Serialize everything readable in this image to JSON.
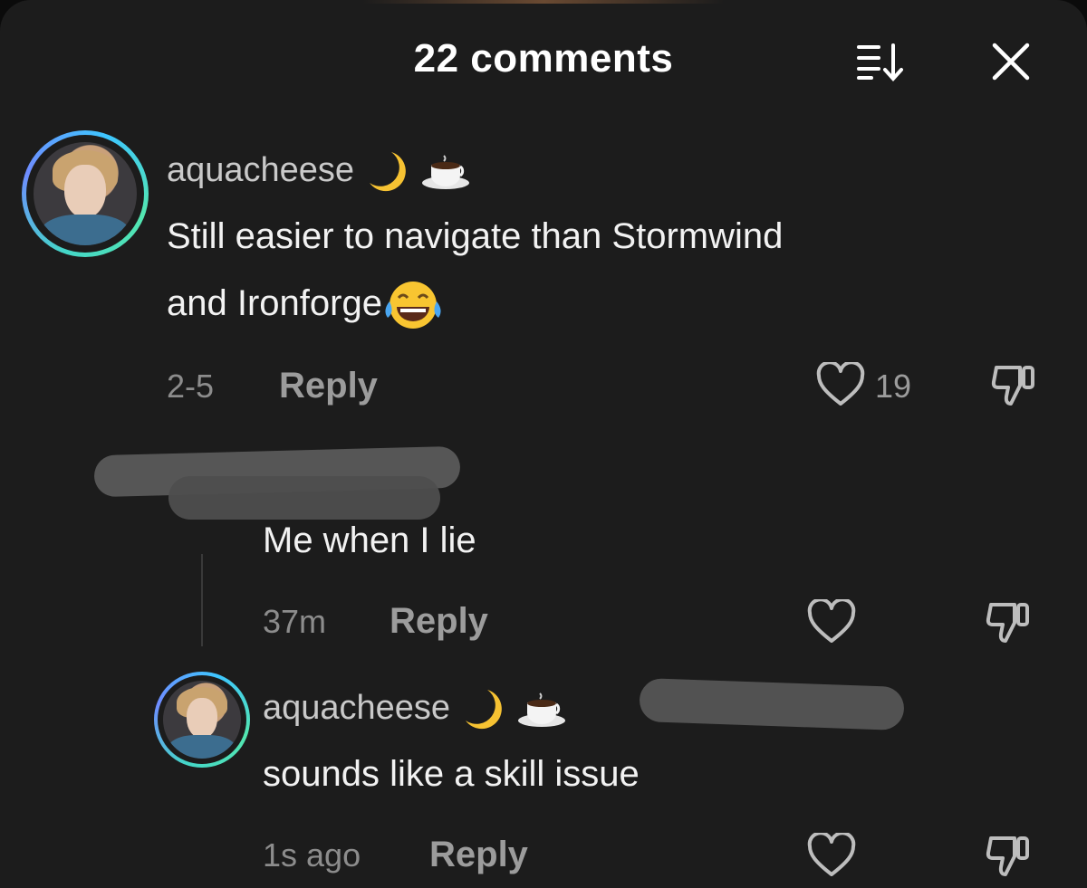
{
  "header": {
    "title": "22 comments"
  },
  "comments": [
    {
      "username": "aquacheese",
      "text_line1": "Still easier to navigate than Stormwind",
      "text_line2": "and Ironforge",
      "time": "2-5",
      "reply_label": "Reply",
      "like_count": "19"
    },
    {
      "username": "",
      "text": "Me when I lie",
      "time": "37m",
      "reply_label": "Reply"
    },
    {
      "username": "aquacheese",
      "text": "sounds like a skill issue",
      "time": "1s ago",
      "reply_label": "Reply"
    }
  ],
  "icons": {
    "sort": "sort-icon",
    "close": "close-icon",
    "like": "heart-icon",
    "dislike": "thumbs-down-icon",
    "moon": "crescent-moon-emoji",
    "coffee": "hot-beverage-emoji",
    "laugh": "tears-of-joy-emoji"
  },
  "colors": {
    "background": "#1c1c1c",
    "text": "#f2f2f2",
    "muted": "#9c9c9c",
    "avatar_ring": "#44d6c8"
  }
}
